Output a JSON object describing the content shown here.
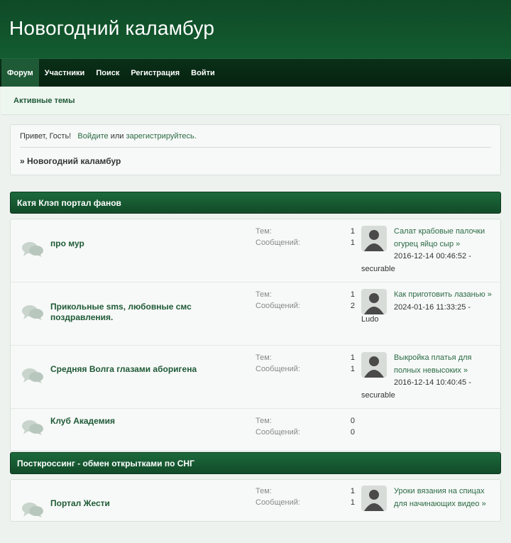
{
  "site": {
    "title": "Новогодний каламбур"
  },
  "nav": {
    "items": [
      {
        "label": "Форум"
      },
      {
        "label": "Участники"
      },
      {
        "label": "Поиск"
      },
      {
        "label": "Регистрация"
      },
      {
        "label": "Войти"
      }
    ]
  },
  "subnav": {
    "active_topics": "Активные темы"
  },
  "welcome": {
    "greeting": "Привет, Гость!",
    "login_link": "Войдите",
    "or_text": "или",
    "register_link": "зарегистрируйтесь.",
    "breadcrumb": "» Новогодний каламбур"
  },
  "labels": {
    "topics": "Тем:",
    "posts": "Сообщений:",
    "arrow": "»"
  },
  "categories": [
    {
      "name": "Катя Клэп портал фанов",
      "forums": [
        {
          "title": "про мур",
          "topics": "1",
          "posts": "1",
          "last_topic": "Салат крабовые палочки огурец яйцо сыр",
          "last_date": "2016-12-14 00:46:52 -",
          "last_user": "securable"
        },
        {
          "title": "Прикольные sms, любовные смс поздравления.",
          "topics": "1",
          "posts": "2",
          "last_topic": "Как приготовить лазанью",
          "last_date": "2024-01-16 11:33:25 -",
          "last_user": "Ludo"
        },
        {
          "title": "Средняя Волга глазами аборигена",
          "topics": "1",
          "posts": "1",
          "last_topic": "Выкройка платья для полных невысоких",
          "last_date": "2016-12-14 10:40:45 -",
          "last_user": "securable"
        },
        {
          "title": "Клуб Академия",
          "topics": "0",
          "posts": "0"
        }
      ]
    },
    {
      "name": "Посткроссинг - обмен открытками по СНГ",
      "forums": [
        {
          "title": "Портал Жести",
          "topics": "1",
          "posts": "1",
          "last_topic": "Уроки вязания на спицах для начинающих видео"
        }
      ]
    }
  ]
}
